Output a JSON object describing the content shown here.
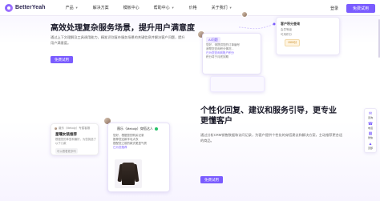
{
  "brand": {
    "name": "BetterYeah",
    "accent": "#7a5cff"
  },
  "nav": {
    "items": [
      {
        "label": "产品",
        "has_dropdown": true
      },
      {
        "label": "解决方案",
        "has_dropdown": false
      },
      {
        "label": "模板中心",
        "has_dropdown": false
      },
      {
        "label": "帮助中心",
        "has_dropdown": true
      },
      {
        "label": "价格",
        "has_dropdown": false
      },
      {
        "label": "关于我们",
        "has_dropdown": true
      }
    ],
    "login": "登录",
    "cta": "免费试用"
  },
  "section1": {
    "title": "高效处理复杂服务场景，提升用户满意度",
    "desc": "通过上下文理解及工具调用能力，精准识别复杂服务场景的关键信息并解决客户问题，提升用户满意度。",
    "button": "免费试用",
    "customer_card": {
      "tag": "AI问题",
      "lines": [
        "您好，请提供您的订单编号",
        "我帮您查询积分情况...",
        "已为您查询到账户积分",
        "积分将于月底到期"
      ]
    },
    "points_panel": {
      "title": "客户积分查询",
      "rows": [
        "会员等级",
        "可用积分"
      ],
      "chip": "1500分"
    }
  },
  "section2": {
    "title": "个性化回复、建议和服务引导，更专业更懂客户",
    "desc": "通过分析CRM销售数据和访问记录，为客户提供个性化的穿搭建议和解决方案，主动推荐更合适的商品。",
    "button": "免费试用",
    "chat_card": {
      "name": "薇乐（Melody）穿搭达人",
      "lines": [
        "您好，根据您的购买记录",
        "推荐您这款羊毛大衣",
        "搭配您之前的款式更显气质",
        "已为您推荐"
      ]
    },
    "left_card": {
      "head": "薇乐（Melody）专属客服",
      "title": "星曜女装推荐",
      "body": "根据您的体型和偏好，为您挑选了以下几款",
      "chip": "可以看看更多吗"
    }
  },
  "sidebar": [
    {
      "icon": "chat-icon",
      "label": "咨询"
    },
    {
      "icon": "phone-icon",
      "label": "电话"
    },
    {
      "icon": "qr-icon",
      "label": "微信"
    },
    {
      "icon": "top-icon",
      "label": "顶部"
    }
  ]
}
